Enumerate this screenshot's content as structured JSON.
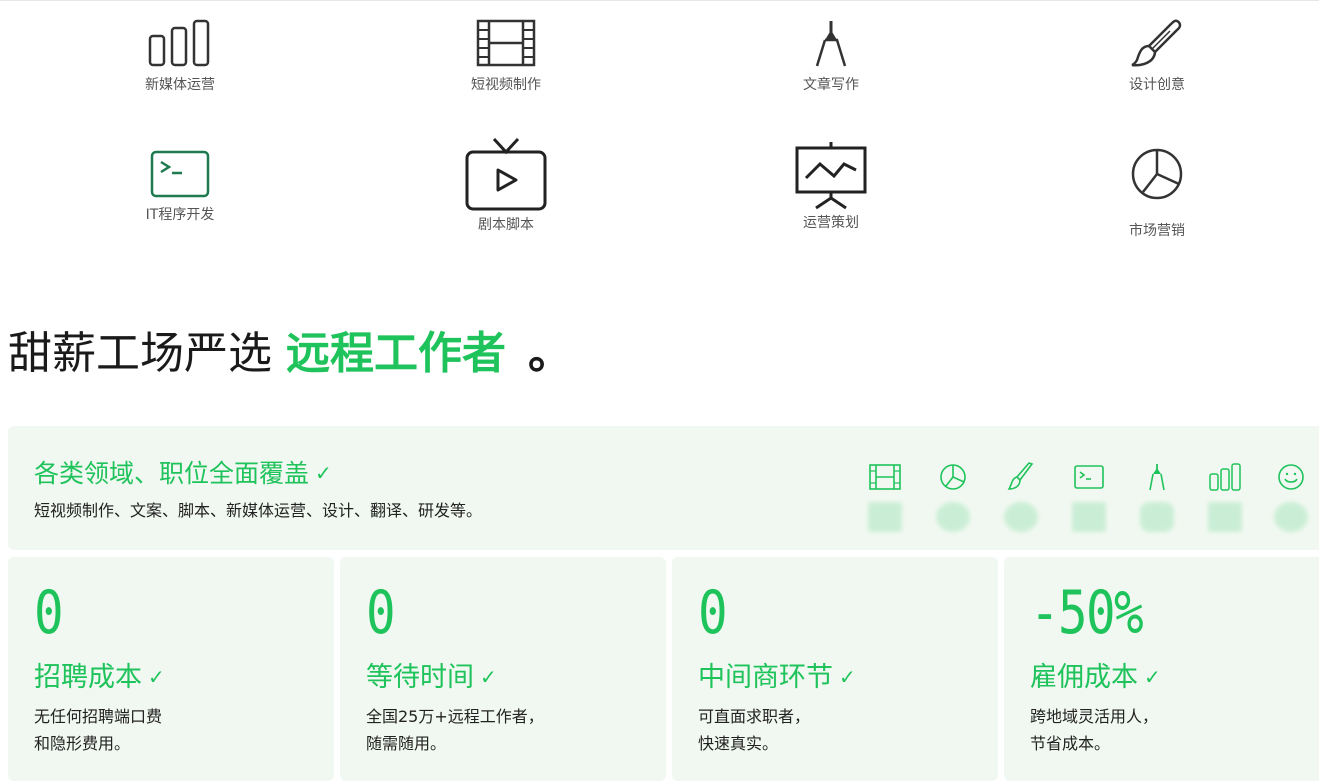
{
  "categories": [
    {
      "label": "新媒体运营",
      "icon": "bar-chart-icon"
    },
    {
      "label": "短视频制作",
      "icon": "film-strip-icon"
    },
    {
      "label": "文章写作",
      "icon": "pen-nib-icon"
    },
    {
      "label": "设计创意",
      "icon": "paint-brush-icon"
    },
    {
      "label": "IT程序开发",
      "icon": "terminal-icon"
    },
    {
      "label": "剧本脚本",
      "icon": "tv-play-icon"
    },
    {
      "label": "运营策划",
      "icon": "presentation-board-icon"
    },
    {
      "label": "市场营销",
      "icon": "pie-chart-icon"
    }
  ],
  "headline": {
    "prefix": "甜薪工场严选",
    "highlight": "远程工作者",
    "suffix": "。"
  },
  "coverage": {
    "title": "各类领域、职位全面覆盖",
    "desc": "短视频制作、文案、脚本、新媒体运营、设计、翻译、研发等。",
    "icons": [
      "film-strip-icon",
      "pie-chart-icon",
      "paint-brush-icon",
      "terminal-icon",
      "pen-nib-icon",
      "bar-chart-icon",
      "smiley-icon"
    ]
  },
  "stats": [
    {
      "value": "0",
      "title": "招聘成本",
      "desc_line1": "无任何招聘端口费",
      "desc_line2": "和隐形费用。"
    },
    {
      "value": "0",
      "title": "等待时间",
      "desc_line1": "全国25万+远程工作者，",
      "desc_line2": "随需随用。"
    },
    {
      "value": "0",
      "title": "中间商环节",
      "desc_line1": "可直面求职者，",
      "desc_line2": "快速真实。"
    },
    {
      "value": "-50%",
      "title": "雇佣成本",
      "desc_line1": "跨地域灵活用人，",
      "desc_line2": "节省成本。"
    }
  ],
  "check_mark": "✓",
  "colors": {
    "accent": "#1fc35b",
    "panel": "#f1f8f1",
    "text": "#222222",
    "terminal_green": "#1e7a4f"
  }
}
